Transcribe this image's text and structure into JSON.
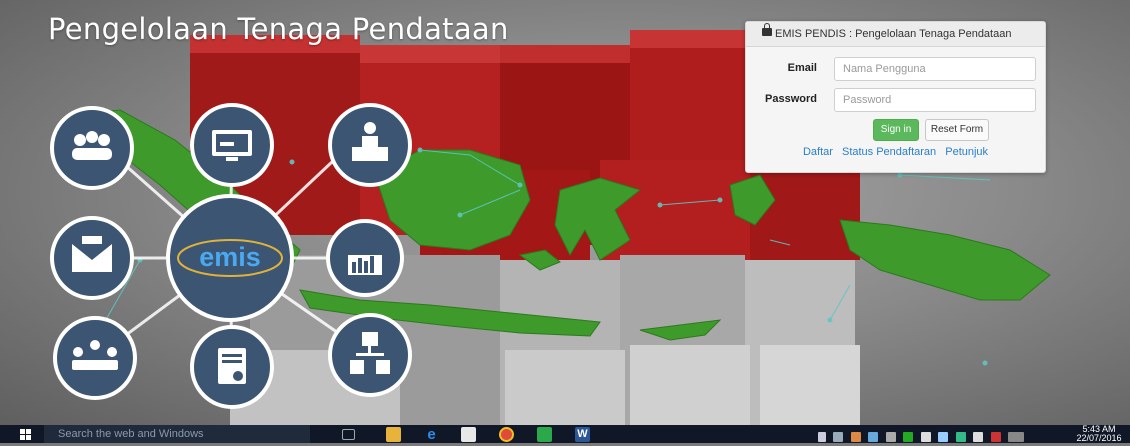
{
  "page": {
    "title": "Pengelolaan Tenaga Pendataan",
    "logo_text": "emis"
  },
  "login": {
    "header": "EMIS PENDIS : Pengelolaan Tenaga Pendataan",
    "email_label": "Email",
    "email_placeholder": "Nama Pengguna",
    "email_value": "",
    "password_label": "Password",
    "password_placeholder": "Password",
    "password_value": "",
    "signin_label": "Sign in",
    "reset_label": "Reset Form",
    "links": [
      "Daftar",
      "Status Pendaftaran",
      "Petunjuk"
    ],
    "accent_color": "#5cb85c",
    "link_color": "#2a7fc9"
  },
  "hub_icons": [
    "people-group-icon",
    "monitor-icon",
    "presenter-icon",
    "envelope-icon",
    "bar-chart-icon",
    "meeting-icon",
    "document-check-icon",
    "org-chart-icon"
  ],
  "taskbar": {
    "search_placeholder": "Search the web and Windows",
    "apps": [
      "task-view-icon",
      "file-explorer-icon",
      "edge-icon",
      "store-icon",
      "chrome-icon",
      "green-app-icon",
      "word-icon"
    ],
    "time": "5:43 AM",
    "date": "22/07/2016"
  }
}
